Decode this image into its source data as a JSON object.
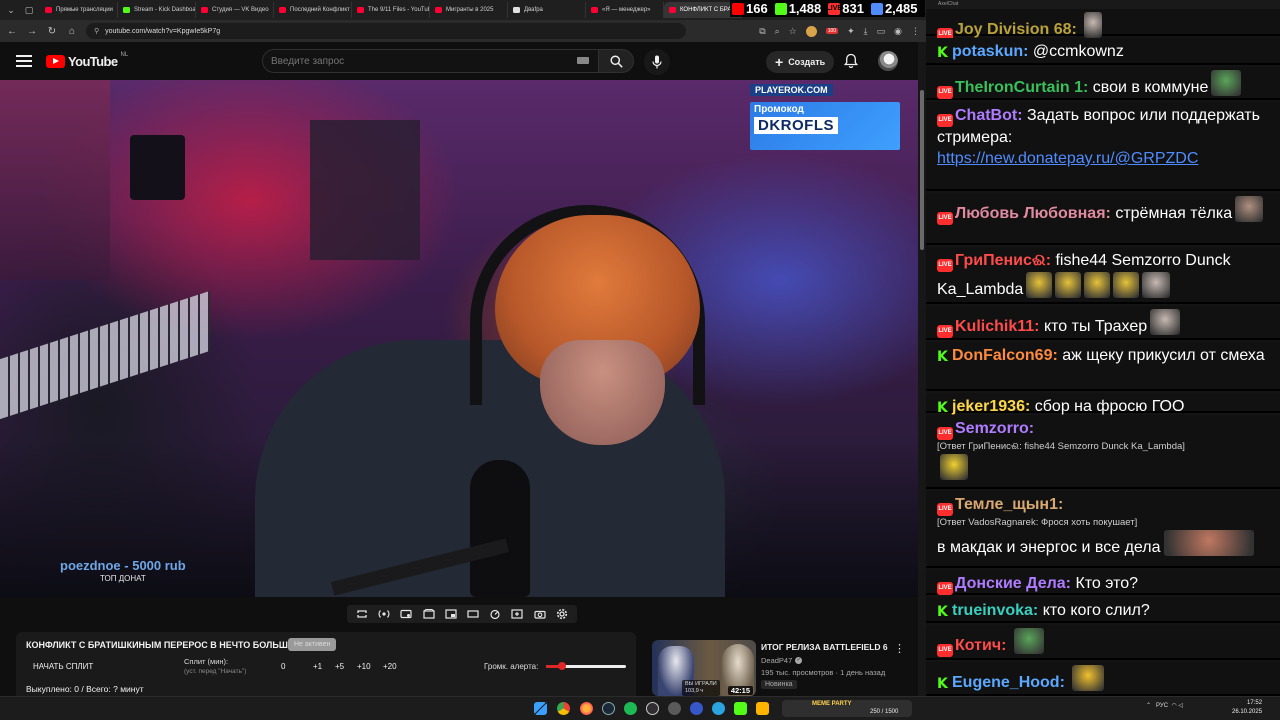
{
  "browser": {
    "tabs": [
      {
        "label": "Прямые трансляции",
        "favicon_color": "#ff0033"
      },
      {
        "label": "Stream - Kick Dashboard",
        "favicon_color": "#53fc18"
      },
      {
        "label": "Студия — VK Видео",
        "favicon_color": "#ff0033"
      },
      {
        "label": "Последний Конфликт",
        "favicon_color": "#ff0033"
      },
      {
        "label": "The 9/11 Files - YouTube",
        "favicon_color": "#ff0033"
      },
      {
        "label": "Мигранты в 2025",
        "favicon_color": "#ff0033"
      },
      {
        "label": "Дваfра",
        "favicon_color": "#e0e0e0"
      },
      {
        "label": "«Я — менеджер»",
        "favicon_color": "#ff0033"
      },
      {
        "label": "КОНФЛИКТ С БРАТ",
        "favicon_color": "#ff0033"
      }
    ],
    "active_tab": 8,
    "url": "youtube.com/watch?v=KpgwIe5kP7g",
    "ext_badge": "100"
  },
  "stream_stats": [
    {
      "icon": "youtube-icon",
      "value": "166",
      "color": "#ff0000"
    },
    {
      "icon": "kick-icon",
      "value": "1,488",
      "color": "#53fc18"
    },
    {
      "icon": "vk-live-icon",
      "label": "LIVE",
      "value": "831",
      "color": "#ff2e2e"
    },
    {
      "icon": "viewers-icon",
      "value": "2,485",
      "color": "#4f8cff"
    }
  ],
  "youtube": {
    "country": "NL",
    "search_placeholder": "Введите запрос",
    "create_label": "Создать"
  },
  "video": {
    "promo_site": "PLAYEROK.COM",
    "promo_label": "Промокод",
    "promo_code": "DKROFLS",
    "top_donate_name": "poezdnoe - 5000 rub",
    "top_donate_label": "ТОП ДОНАТ"
  },
  "split": {
    "title": "КОНФЛИКТ С БРАТИШКИНЫМ ПЕРЕРОС В НЕЧТО БОЛЬШЕЕ...",
    "badge": "Не активен",
    "start_label": "НАЧАТЬ СПЛИТ",
    "minutes_label": "Сплит (мин):",
    "minutes_sub": "(уст. перед \"Начать\")",
    "current": "0",
    "increments": [
      "+1",
      "+5",
      "+10",
      "+20"
    ],
    "volume_label": "Громк. алерта:",
    "volume_level": 0.2,
    "total": "Выкуплено: 0 / Всего: ? минут"
  },
  "recommended": {
    "title": "ИТОГ РЕЛИЗА BATTLEFIELD 6",
    "channel": "DeadP47",
    "views": "195 тыс. просмотров · 1 день назад",
    "tag": "Новинка",
    "duration": "42:15",
    "thumb_badge_1": "ВЫ ИГРАЛИ",
    "thumb_badge_2": "103,9 ч"
  },
  "chat": {
    "window_title": "AxelChat",
    "messages": [
      {
        "platform": "live",
        "user": "Joy Division 68",
        "color": "#b9a23a",
        "text": ""
      },
      {
        "platform": "kick",
        "user": "potaskun",
        "color": "#5aa8ff",
        "text": "@ccmkownz"
      },
      {
        "platform": "live",
        "user": "TheIronCurtain 1",
        "color": "#39c05a",
        "text": "свои в коммуне"
      },
      {
        "platform": "live",
        "user": "ChatBot",
        "color": "#b07cff",
        "text": "Задать вопрос или поддержать стримера:",
        "link": "https://new.donatepay.ru/@GRPZDC"
      },
      {
        "platform": "live",
        "user": "Любовь Любовная",
        "color": "#e08aa0",
        "text": "стрёмная тёлка"
      },
      {
        "platform": "live",
        "user": "ГриПенисଈ",
        "color": "#ff4b4b",
        "text": "fishe44 Semzorro Dunck Ka_Lambda"
      },
      {
        "platform": "live",
        "user": "Kulichik11",
        "color": "#ff4b4b",
        "text": "кто ты Трахер"
      },
      {
        "platform": "kick",
        "user": "DonFalcon69",
        "color": "#ff8a3d",
        "text": "аж щеку прикусил от смеха"
      },
      {
        "platform": "kick",
        "user": "jeker1936",
        "color": "#ffd84a",
        "text": "сбор на фросю ГОО"
      },
      {
        "platform": "live",
        "user": "Semzorro",
        "color": "#b07cff",
        "text": "",
        "reply": "[Ответ ГриПенисଈ: fishe44 Semzorro Dunck Ka_Lambda]"
      },
      {
        "platform": "live",
        "user": "Темле_щын1",
        "color": "#d8a872",
        "text": "в макдак и энергос и все дела",
        "reply": "[Ответ VadosRagnarek: Фрося хоть покушает]"
      },
      {
        "platform": "live",
        "user": "Донские Дела",
        "color": "#b07cff",
        "text": "Кто это?"
      },
      {
        "platform": "kick",
        "user": "trueinvoka",
        "color": "#39d0c0",
        "text": "кто кого слил?"
      },
      {
        "platform": "live",
        "user": "Котич",
        "color": "#ff4b4b",
        "text": ""
      },
      {
        "platform": "kick",
        "user": "Eugene_Hood",
        "color": "#5aa8ff",
        "text": ""
      }
    ]
  },
  "taskbar": {
    "widget_title": "MEME PARTY",
    "widget_value": "250 / 1500",
    "lang": "РУС",
    "time": "17:52",
    "date": "26.10.2025"
  }
}
